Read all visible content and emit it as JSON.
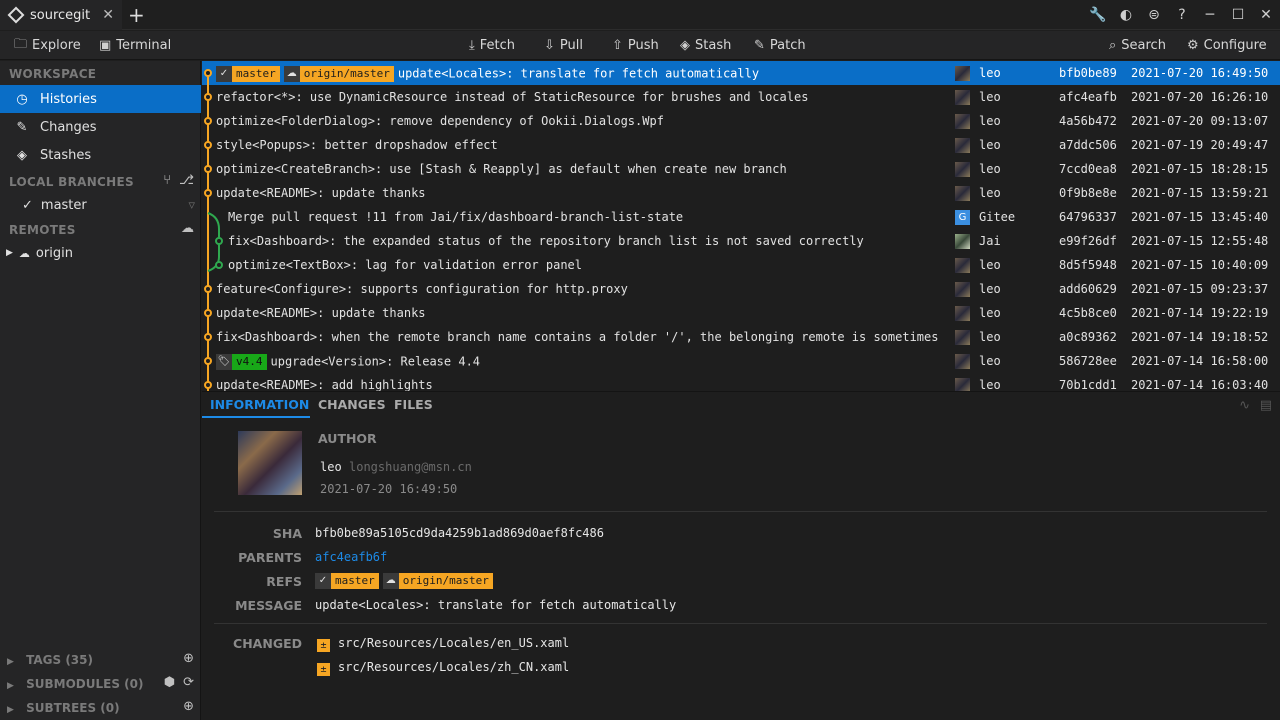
{
  "app": {
    "tab_title": "sourcegit",
    "tab_close": "✕",
    "add_tab": "+"
  },
  "toolbar": {
    "explore": "Explore",
    "terminal": "Terminal",
    "fetch": "Fetch",
    "pull": "Pull",
    "push": "Push",
    "stash": "Stash",
    "patch": "Patch",
    "search": "Search",
    "configure": "Configure"
  },
  "sidebar": {
    "workspace_title": "WORKSPACE",
    "nav": [
      {
        "label": "Histories"
      },
      {
        "label": "Changes"
      },
      {
        "label": "Stashes"
      }
    ],
    "local_branches_title": "LOCAL BRANCHES",
    "local_branches": [
      {
        "label": "master"
      }
    ],
    "remotes_title": "REMOTES",
    "remotes": [
      {
        "label": "origin"
      }
    ],
    "tags_title": "TAGS (35)",
    "submodules_title": "SUBMODULES (0)",
    "subtrees_title": "SUBTREES (0)"
  },
  "commits": [
    {
      "message": "update<Locales>: translate for fetch automatically",
      "author": "leo",
      "sha": "bfb0be89",
      "time": "2021-07-20 16:49:50",
      "refs": [
        "master",
        "origin/master"
      ]
    },
    {
      "message": "refactor<*>: use DynamicResource instead of StaticResource for brushes and locales",
      "author": "leo",
      "sha": "afc4eafb",
      "time": "2021-07-20 16:26:10"
    },
    {
      "message": "optimize<FolderDialog>: remove dependency of Ookii.Dialogs.Wpf",
      "author": "leo",
      "sha": "4a56b472",
      "time": "2021-07-20 09:13:07"
    },
    {
      "message": "style<Popups>: better dropshadow effect",
      "author": "leo",
      "sha": "a7ddc506",
      "time": "2021-07-19 20:49:47"
    },
    {
      "message": "optimize<CreateBranch>: use [Stash & Reapply] as default when create new branch",
      "author": "leo",
      "sha": "7ccd0ea8",
      "time": "2021-07-15 18:28:15"
    },
    {
      "message": "update<README>: update thanks",
      "author": "leo",
      "sha": "0f9b8e8e",
      "time": "2021-07-15 13:59:21"
    },
    {
      "message": "Merge pull request !11 from Jai/fix/dashboard-branch-list-state",
      "author": "Gitee",
      "sha": "64796337",
      "time": "2021-07-15 13:45:40"
    },
    {
      "message": "fix<Dashboard>: the expanded status of the repository branch list is not saved correctly",
      "author": "Jai",
      "sha": "e99f26df",
      "time": "2021-07-15 12:55:48"
    },
    {
      "message": "optimize<TextBox>: lag for validation error panel",
      "author": "leo",
      "sha": "8d5f5948",
      "time": "2021-07-15 10:40:09"
    },
    {
      "message": "feature<Configure>: supports configuration for http.proxy",
      "author": "leo",
      "sha": "add60629",
      "time": "2021-07-15 09:23:37"
    },
    {
      "message": "update<README>: update thanks",
      "author": "leo",
      "sha": "4c5b8ce0",
      "time": "2021-07-14 19:22:19"
    },
    {
      "message": "fix<Dashboard>: when the remote branch name contains a folder '/', the belonging remote is sometimes inco",
      "author": "leo",
      "sha": "a0c89362",
      "time": "2021-07-14 19:18:52"
    },
    {
      "message": "upgrade<Version>: Release 4.4",
      "author": "leo",
      "sha": "586728ee",
      "time": "2021-07-14 16:58:00",
      "tag": "v4.4"
    },
    {
      "message": "update<README>: add highlights",
      "author": "leo",
      "sha": "70b1cdd1",
      "time": "2021-07-14 16:03:40"
    }
  ],
  "details": {
    "tabs": [
      "INFORMATION",
      "CHANGES",
      "FILES"
    ],
    "author_label": "AUTHOR",
    "author_name": "leo",
    "author_email": "longshuang@msn.cn",
    "author_time": "2021-07-20 16:49:50",
    "sha_label": "SHA",
    "sha": "bfb0be89a5105cd9da4259b1ad869d0aef8fc486",
    "parents_label": "PARENTS",
    "parent": "afc4eafb6f",
    "refs_label": "REFS",
    "refs": [
      "master",
      "origin/master"
    ],
    "message_label": "MESSAGE",
    "message": "update<Locales>: translate for fetch automatically",
    "changed_label": "CHANGED",
    "changed_files": [
      "src/Resources/Locales/en_US.xaml",
      "src/Resources/Locales/zh_CN.xaml"
    ]
  },
  "colors": {
    "accent": "#0a6ec7",
    "branch": "#f6a623",
    "tag": "#18a818"
  }
}
